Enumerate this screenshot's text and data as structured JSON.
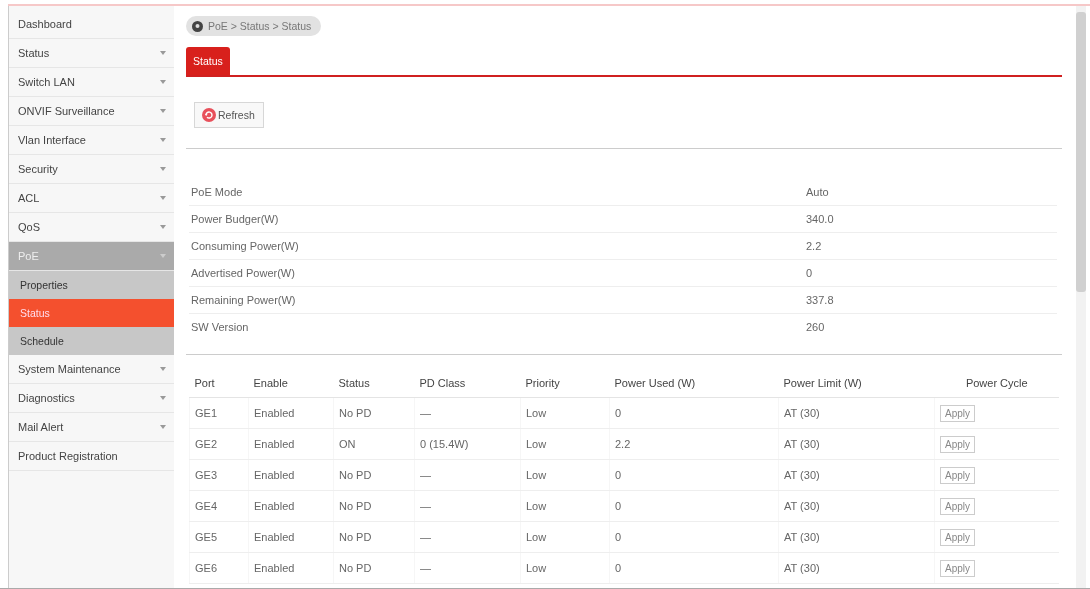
{
  "sidebar": {
    "items": [
      {
        "label": "Dashboard",
        "expandable": false,
        "expanded": false
      },
      {
        "label": "Status",
        "expandable": true,
        "expanded": false
      },
      {
        "label": "Switch LAN",
        "expandable": true,
        "expanded": false
      },
      {
        "label": "ONVIF Surveillance",
        "expandable": true,
        "expanded": false
      },
      {
        "label": "Vlan Interface",
        "expandable": true,
        "expanded": false
      },
      {
        "label": "Security",
        "expandable": true,
        "expanded": false
      },
      {
        "label": "ACL",
        "expandable": true,
        "expanded": false
      },
      {
        "label": "QoS",
        "expandable": true,
        "expanded": false
      },
      {
        "label": "PoE",
        "expandable": true,
        "expanded": true,
        "children": [
          {
            "label": "Properties",
            "selected": false
          },
          {
            "label": "Status",
            "selected": true
          },
          {
            "label": "Schedule",
            "selected": false
          }
        ]
      },
      {
        "label": "System Maintenance",
        "expandable": true,
        "expanded": false
      },
      {
        "label": "Diagnostics",
        "expandable": true,
        "expanded": false
      },
      {
        "label": "Mail Alert",
        "expandable": true,
        "expanded": false
      },
      {
        "label": "Product Registration",
        "expandable": false,
        "expanded": false
      }
    ]
  },
  "breadcrumb": "PoE > Status > Status",
  "tabs": [
    {
      "label": "Status",
      "selected": true
    }
  ],
  "refresh_button": "Refresh",
  "info": [
    {
      "label": "PoE Mode",
      "value": "Auto"
    },
    {
      "label": "Power Budger(W)",
      "value": "340.0"
    },
    {
      "label": "Consuming Power(W)",
      "value": "2.2"
    },
    {
      "label": "Advertised Power(W)",
      "value": "0"
    },
    {
      "label": "Remaining Power(W)",
      "value": "337.8"
    },
    {
      "label": "SW Version",
      "value": "260"
    }
  ],
  "table": {
    "columns": [
      "Port",
      "Enable",
      "Status",
      "PD Class",
      "Priority",
      "Power Used (W)",
      "Power Limit (W)",
      "Power Cycle"
    ],
    "rows": [
      {
        "cells": [
          "GE1",
          "Enabled",
          "No PD",
          "—",
          "Low",
          "0",
          "AT (30)"
        ],
        "action": "Apply"
      },
      {
        "cells": [
          "GE2",
          "Enabled",
          "ON",
          "0 (15.4W)",
          "Low",
          "2.2",
          "AT (30)"
        ],
        "action": "Apply"
      },
      {
        "cells": [
          "GE3",
          "Enabled",
          "No PD",
          "—",
          "Low",
          "0",
          "AT (30)"
        ],
        "action": "Apply"
      },
      {
        "cells": [
          "GE4",
          "Enabled",
          "No PD",
          "—",
          "Low",
          "0",
          "AT (30)"
        ],
        "action": "Apply"
      },
      {
        "cells": [
          "GE5",
          "Enabled",
          "No PD",
          "—",
          "Low",
          "0",
          "AT (30)"
        ],
        "action": "Apply"
      },
      {
        "cells": [
          "GE6",
          "Enabled",
          "No PD",
          "—",
          "Low",
          "0",
          "AT (30)"
        ],
        "action": "Apply"
      }
    ]
  }
}
